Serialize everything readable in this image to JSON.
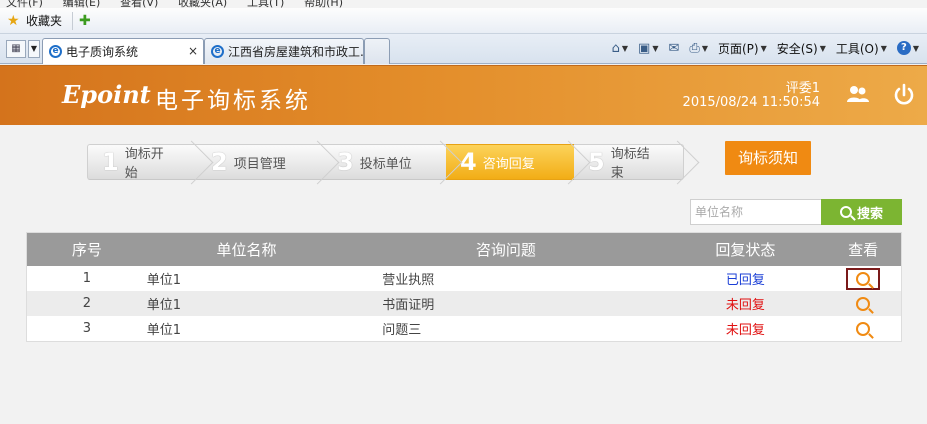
{
  "browser": {
    "menu_items": [
      "文件(F)",
      "编辑(E)",
      "查看(V)",
      "收藏夹(A)",
      "工具(T)",
      "帮助(H)"
    ],
    "favorites_label": "收藏夹",
    "tabs": [
      {
        "label": "电子质询系统",
        "active": true
      },
      {
        "label": "江西省房屋建筑和市政工...",
        "active": false
      }
    ],
    "commands": {
      "page": "页面(P)",
      "safety": "安全(S)",
      "tools": "工具(O)"
    }
  },
  "header": {
    "logo": "Epoint",
    "title": "电子询标系统",
    "user": "评委1",
    "datetime": "2015/08/24 11:50:54"
  },
  "steps": [
    {
      "num": "1",
      "label": "询标开始",
      "active": false
    },
    {
      "num": "2",
      "label": "项目管理",
      "active": false
    },
    {
      "num": "3",
      "label": "投标单位",
      "active": false
    },
    {
      "num": "4",
      "label": "咨询回复",
      "active": true
    },
    {
      "num": "5",
      "label": "询标结束",
      "active": false
    }
  ],
  "notice_button": "询标须知",
  "search": {
    "placeholder": "单位名称",
    "button": "搜索"
  },
  "table": {
    "headers": [
      "序号",
      "单位名称",
      "咨询问题",
      "回复状态",
      "查看"
    ],
    "rows": [
      {
        "index": "1",
        "unit": "单位1",
        "question": "营业执照",
        "status": "已回复",
        "status_type": "replied"
      },
      {
        "index": "2",
        "unit": "单位1",
        "question": "书面证明",
        "status": "未回复",
        "status_type": "pending"
      },
      {
        "index": "3",
        "unit": "单位1",
        "question": "问题三",
        "status": "未回复",
        "status_type": "pending"
      }
    ]
  },
  "colors": {
    "header_orange": "#e38d2a",
    "active_step": "#f2ad16",
    "notice_button": "#f08a12",
    "search_button": "#7cb532",
    "replied": "#1b3fd6",
    "pending": "#e01010"
  }
}
